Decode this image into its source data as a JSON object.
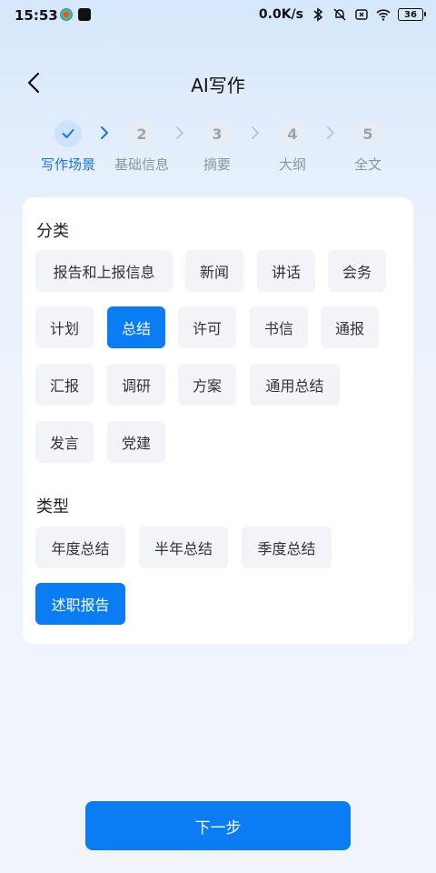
{
  "status_bar": {
    "time": "15:53",
    "net_speed": "0.0K/s",
    "battery": "36"
  },
  "header": {
    "title": "AI写作"
  },
  "stepper": {
    "steps": [
      {
        "num": "",
        "label": "写作场景",
        "state": "done"
      },
      {
        "num": "2",
        "label": "基础信息",
        "state": "pending"
      },
      {
        "num": "3",
        "label": "摘要",
        "state": "pending"
      },
      {
        "num": "4",
        "label": "大纲",
        "state": "pending"
      },
      {
        "num": "5",
        "label": "全文",
        "state": "pending"
      }
    ]
  },
  "category": {
    "title": "分类",
    "options": [
      "报告和上报信息",
      "新闻",
      "讲话",
      "会务",
      "计划",
      "总结",
      "许可",
      "书信",
      "通报",
      "汇报",
      "调研",
      "方案",
      "通用总结",
      "发言",
      "党建"
    ],
    "selected": "总结"
  },
  "type": {
    "title": "类型",
    "options": [
      "年度总结",
      "半年总结",
      "季度总结",
      "述职报告"
    ],
    "selected": "述职报告"
  },
  "footer": {
    "next_label": "下一步"
  },
  "colors": {
    "accent": "#0a7cf4",
    "chip_bg": "#f3f4f7"
  }
}
